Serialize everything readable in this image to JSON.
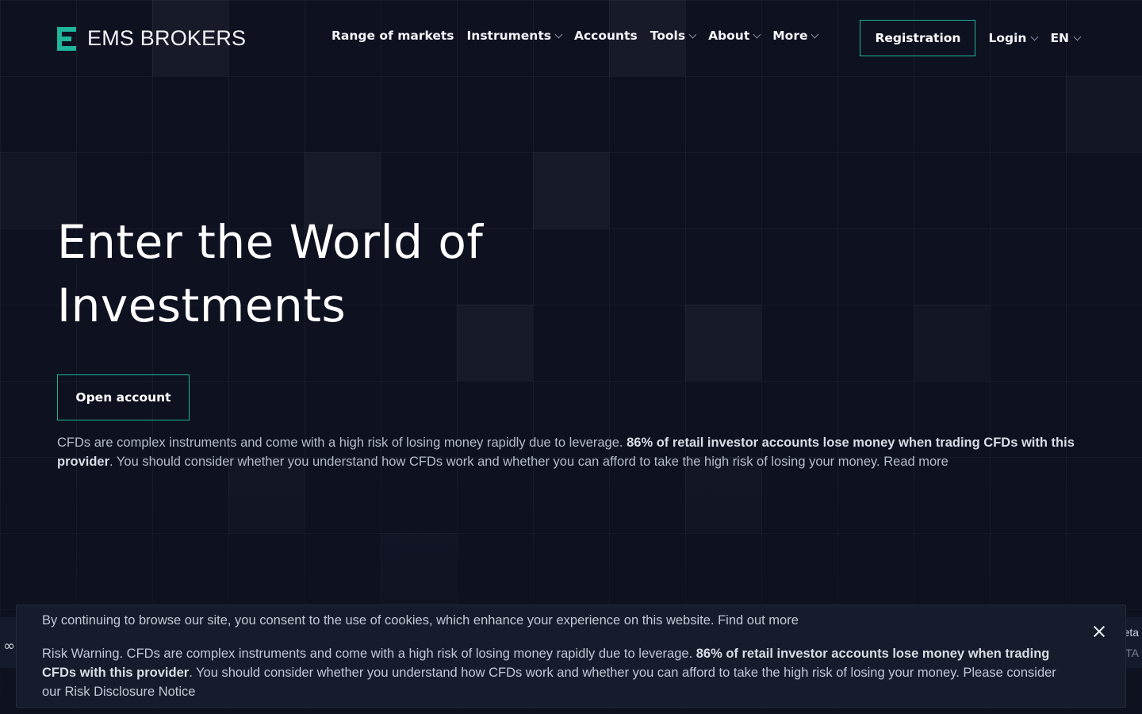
{
  "brand": {
    "name": "EMS BROKERS",
    "accent": "#1fb59a",
    "background": "#0d1120"
  },
  "nav": {
    "items": [
      {
        "label": "Range of markets",
        "dropdown": false
      },
      {
        "label": "Instruments",
        "dropdown": true
      },
      {
        "label": "Accounts",
        "dropdown": false
      },
      {
        "label": "Tools",
        "dropdown": true
      },
      {
        "label": "About",
        "dropdown": true
      },
      {
        "label": "More",
        "dropdown": true
      }
    ]
  },
  "header": {
    "registration_label": "Registration",
    "login_label": "Login",
    "language_label": "EN"
  },
  "hero": {
    "title_line1": "Enter the World of",
    "title_line2": "Investments",
    "cta_label": "Open account",
    "risk_pre": "CFDs are complex instruments and come with a high risk of losing money rapidly due to leverage. ",
    "risk_bold": "86% of retail investor accounts lose money when trading CFDs with this provider",
    "risk_post": ". You should consider whether you understand how CFDs work and whether you can afford to take the high risk of losing your money. ",
    "read_more_label": "Read more"
  },
  "ticker": {
    "left_fragment": "∞",
    "right_fragment_top": "eta",
    "right_fragment_bottom": "ETA"
  },
  "cookie_banner": {
    "consent_text": "By continuing to browse our site, you consent to the use of cookies, which enhance your experience on this website. ",
    "find_out_more_label": "Find out more",
    "risk_pre": "Risk Warning. CFDs are complex instruments and come with a high risk of losing money rapidly due to leverage. ",
    "risk_bold": "86% of retail investor accounts lose money when trading CFDs with this provider",
    "risk_post": ". You should consider whether you understand how CFDs work and whether you can afford to take the high risk of losing your money. Please consider our ",
    "risk_link_label": "Risk Disclosure Notice",
    "close_icon": "close-icon"
  }
}
